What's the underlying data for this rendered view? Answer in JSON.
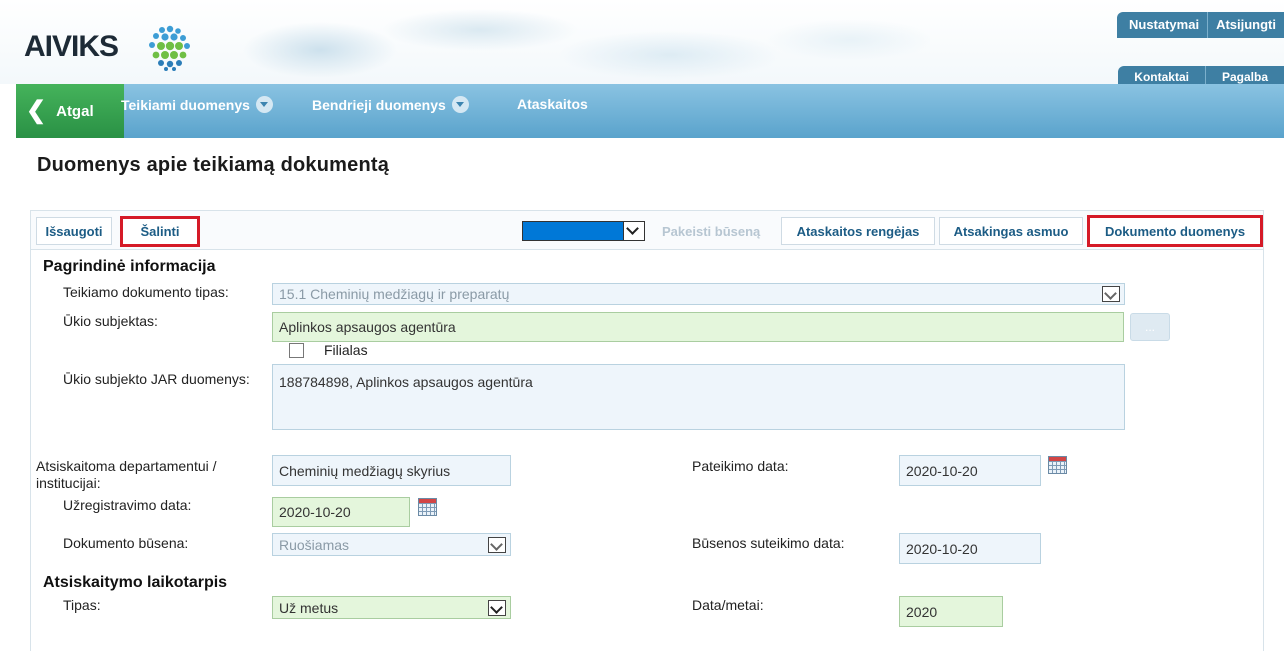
{
  "header": {
    "logo_text": "AIVIKS",
    "top_tabs": [
      "Nustatymai",
      "Atsijungti"
    ],
    "secondary_tabs": [
      "Kontaktai",
      "Pagalba"
    ]
  },
  "nav": {
    "back_label": "Atgal",
    "items": [
      {
        "label": "Teikiami duomenys",
        "has_dropdown": true
      },
      {
        "label": "Bendrieji duomenys",
        "has_dropdown": true
      },
      {
        "label": "Ataskaitos",
        "has_dropdown": false
      }
    ]
  },
  "page_title": "Duomenys apie teikiamą dokumentą",
  "toolbar": {
    "save_label": "Išsaugoti",
    "delete_label": "Šalinti",
    "status_select_value": "",
    "change_status_label": "Pakeisti būseną",
    "report_preparer_label": "Ataskaitos rengėjas",
    "responsible_person_label": "Atsakingas asmuo",
    "document_data_label": "Dokumento duomenys"
  },
  "main_info": {
    "section_title": "Pagrindinė informacija",
    "doc_type_label": "Teikiamo dokumento tipas:",
    "doc_type_value": "15.1 Cheminių medžiagų ir preparatų",
    "entity_label": "Ūkio subjektas:",
    "entity_value": "Aplinkos apsaugos agentūra",
    "entity_button_label": "...",
    "branch_label": "Filialas",
    "branch_checked": false,
    "jar_label": "Ūkio subjekto JAR duomenys:",
    "jar_value": "188784898, Aplinkos apsaugos agentūra",
    "department_label": "Atsiskaitoma departamentui / institucijai:",
    "department_value": "Cheminių medžiagų skyrius",
    "submission_date_label": "Pateikimo data:",
    "submission_date_value": "2020-10-20",
    "registration_date_label": "Užregistravimo data:",
    "registration_date_value": "2020-10-20",
    "doc_status_label": "Dokumento būsena:",
    "doc_status_value": "Ruošiamas",
    "status_date_label": "Būsenos suteikimo data:",
    "status_date_value": "2020-10-20"
  },
  "period": {
    "section_title": "Atsiskaitymo laikotarpis",
    "type_label": "Tipas:",
    "type_value": "Už metus",
    "year_label": "Data/metai:",
    "year_value": "2020"
  },
  "colors": {
    "nav_blue": "#5aa3cc",
    "back_green": "#2a9145",
    "highlight_red": "#d51a27",
    "select_blue": "#0078d7"
  }
}
